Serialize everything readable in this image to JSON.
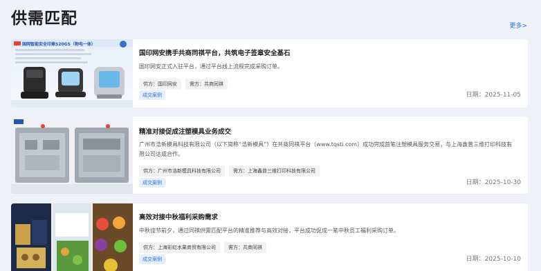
{
  "page": {
    "title": "供需匹配",
    "more": "更多>"
  },
  "items": [
    {
      "title": "国印网安携手共商同祺平台，共筑电子签章安全基石",
      "description": "国印网安正式入驻平台，通过平台线上流程完成采购订单。",
      "supplier": "供方：国印网安",
      "demander": "需方：共商同祺",
      "badge": "成交案例",
      "date_label": "日期：",
      "date": "2025-11-05",
      "thumb_banner": "国网智能安全印章S20GS（物电一体）"
    },
    {
      "title": "精准对接促成注塑模具业务成交",
      "description": "广州市浩新模具科技有限公司（以下简称“浩新模具”）在共商同祺平台（www.tqsti.com）成功完成首笔注塑模具服务交易，与上海鑫普三维打印科技有限公司达成合作。",
      "supplier": "供方：广州市浩新模具科技有限公司",
      "demander": "需方：上海鑫普三维打印科技有限公司",
      "badge": "成交案例",
      "date_label": "日期：",
      "date": "2025-10-30"
    },
    {
      "title": "高效对接中秋福利采购需求",
      "description": "中秋佳节前夕，通过同祺供需匹配平台的精准推荐与高效对接，平台成功促成一笔中秋员工福利采购订单。",
      "supplier": "供方：上海彩虹水果商贸有限公司",
      "demander": "需方：共商同祺",
      "badge": "成交案例",
      "date_label": "日期：",
      "date": "2025-10-10"
    }
  ],
  "colors": {
    "accent": "#2f6fe0",
    "background": "#eef2f8"
  }
}
